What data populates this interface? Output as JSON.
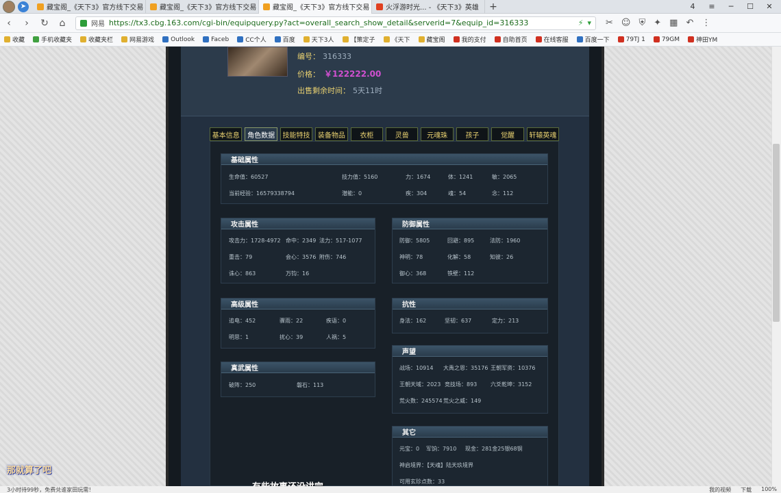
{
  "browser": {
    "tabs": [
      {
        "label": "藏宝阁_《天下3》官方线下交易",
        "active": false
      },
      {
        "label": "藏宝阁_《天下3》官方线下交易",
        "active": false
      },
      {
        "label": "藏宝阁_《天下3》官方线下交易",
        "active": true
      },
      {
        "label": "火浮游时光... - 《天下3》英雄",
        "active": false
      }
    ],
    "tab_count": "4",
    "site_label": "网易",
    "url": "https://tx3.cbg.163.com/cgi-bin/equipquery.py?act=overall_search_show_detail&serverid=7&equip_id=316333",
    "bookmarks": [
      "收藏",
      "手机收藏夹",
      "收藏夹栏",
      "网易游戏",
      "Outlook",
      "Faceb",
      "CC个人",
      "百度",
      "天下3人",
      "【策定子",
      "《天下",
      "藏宝阁",
      "我的支付",
      "自助首页",
      "在线客服",
      "百度一下",
      "79TJ 1",
      "79GM",
      "神田YM"
    ]
  },
  "item": {
    "id_label": "编号：",
    "id_value": "316333",
    "price_label": "价格：",
    "price_value": "￥122222.00",
    "time_label": "出售剩余时间：",
    "time_value": "5天11时"
  },
  "tabs": [
    {
      "label": "基本信息",
      "active": false
    },
    {
      "label": "角色数据",
      "active": true
    },
    {
      "label": "技能特技",
      "active": false
    },
    {
      "label": "装备物品",
      "active": false
    },
    {
      "label": "衣柜",
      "active": false
    },
    {
      "label": "灵兽",
      "active": false
    },
    {
      "label": "元魂珠",
      "active": false
    },
    {
      "label": "孩子",
      "active": false
    },
    {
      "label": "觉醒",
      "active": false
    },
    {
      "label": "轩辕英魂",
      "active": false
    }
  ],
  "sections": {
    "basic": {
      "title": "基础属性",
      "stats": [
        "生命值：60527",
        "技力值：5160",
        "力：1674",
        "体：1241",
        "敏：2065",
        "当前经验：16579338794",
        "潜能：0",
        "疾：304",
        "魂：54",
        "念：112"
      ]
    },
    "attack": {
      "title": "攻击属性",
      "stats": [
        "攻击力：1728-4972",
        "命中：2349",
        "法力：517-1077",
        "重击：79",
        "会心：3576",
        "附伤：746",
        "诛心：863",
        "万钧：16"
      ]
    },
    "defense": {
      "title": "防御属性",
      "stats": [
        "防御：5805",
        "回避：895",
        "法防：1960",
        "神明：78",
        "化解：58",
        "知彼：26",
        "御心：368",
        "铁壁：112"
      ]
    },
    "advanced": {
      "title": "高级属性",
      "stats": [
        "追电：452",
        "骤雨：22",
        "疾语：0",
        "明思：1",
        "扰心：39",
        "人祸：5"
      ]
    },
    "resist": {
      "title": "抗性",
      "stats": [
        "身法：162",
        "坚韧：637",
        "定力：213"
      ]
    },
    "zhenwu": {
      "title": "真武属性",
      "stats": [
        "破阵：250",
        "磐石：113"
      ]
    },
    "fame": {
      "title": "声望",
      "stats": [
        "战场：10914",
        "大禹之恩：35176",
        "王朝军资：10376",
        "王朝天域：2023",
        "竞技场：893",
        "六爻乾坤：3152",
        "荒火数：245574",
        "荒火之威：149"
      ]
    },
    "other": {
      "title": "其它",
      "stats": [
        "元宝：0",
        "军饷：7910",
        "现金：281金25银68铜",
        "神启境界：【天魂】陆天玖境界",
        "可用玄珍点数：33"
      ]
    }
  },
  "overlay": {
    "tag": "那就算了吧",
    "subtitle": "有些故事还没讲完"
  },
  "statusbar": {
    "left": "3小时待99秒，免费兑谁家田玩需！",
    "items": [
      "我的视频",
      "下载",
      "100%"
    ]
  }
}
